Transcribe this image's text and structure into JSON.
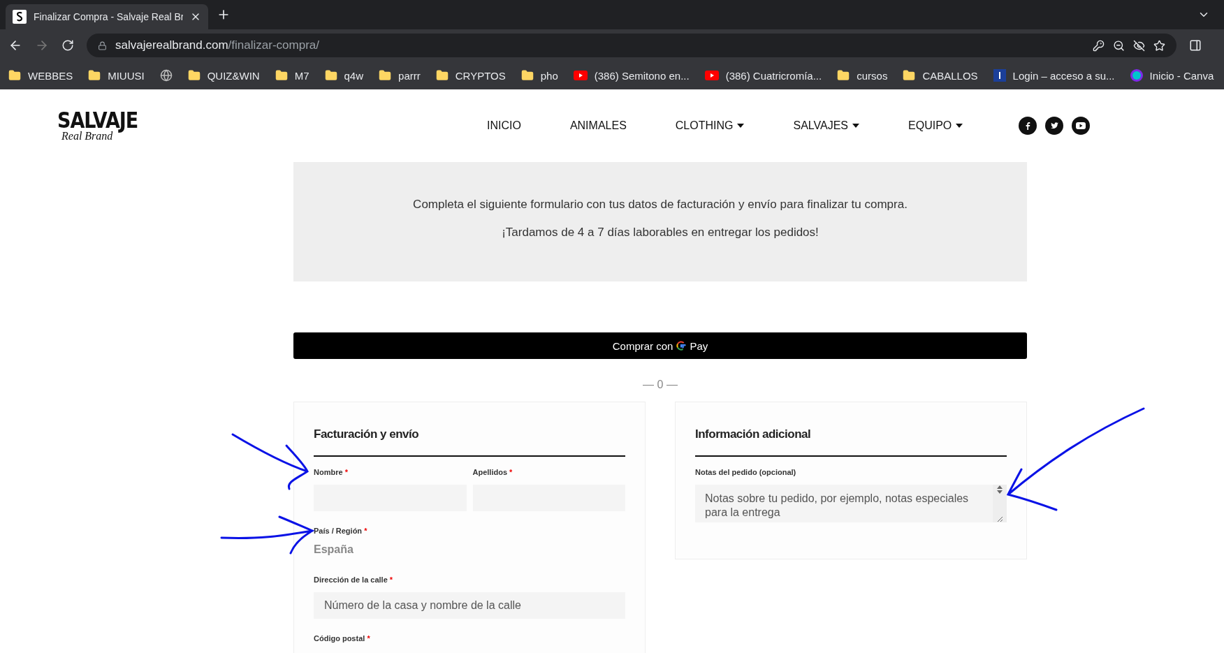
{
  "browser": {
    "tab": {
      "title": "Finalizar Compra - Salvaje Real Br",
      "selected": true
    },
    "address": {
      "domain": "salvajerealbrand.com",
      "path": "/finalizar-compra/"
    },
    "bookmarks": [
      {
        "kind": "folder",
        "label": "WEBBES"
      },
      {
        "kind": "folder",
        "label": "MIUUSI"
      },
      {
        "kind": "globe"
      },
      {
        "kind": "folder",
        "label": "QUIZ&WIN"
      },
      {
        "kind": "folder",
        "label": "M7"
      },
      {
        "kind": "folder",
        "label": "q4w"
      },
      {
        "kind": "folder",
        "label": "parrr"
      },
      {
        "kind": "folder",
        "label": "CRYPTOS"
      },
      {
        "kind": "folder",
        "label": "pho"
      },
      {
        "kind": "video",
        "label": "(386) Semitono en..."
      },
      {
        "kind": "video",
        "label": "(386) Cuatricromía..."
      },
      {
        "kind": "folder",
        "label": "cursos"
      },
      {
        "kind": "folder",
        "label": "CABALLOS"
      },
      {
        "kind": "site",
        "label": "Login – acceso a su..."
      },
      {
        "kind": "canva",
        "label": "Inicio - Canva"
      }
    ]
  },
  "site": {
    "logo": {
      "title": "SALVAJE",
      "subtitle": "Real Brand"
    },
    "nav": [
      {
        "label": "INICIO",
        "dropdown": false
      },
      {
        "label": "ANIMALES",
        "dropdown": false
      },
      {
        "label": "CLOTHING",
        "dropdown": true
      },
      {
        "label": "SALVAJES",
        "dropdown": true
      },
      {
        "label": "EQUIPO",
        "dropdown": true
      }
    ],
    "social": [
      {
        "kind": "facebook"
      },
      {
        "kind": "twitter"
      },
      {
        "kind": "youtube"
      }
    ]
  },
  "intro": {
    "lines": [
      "Completa el siguiente formulario con tus datos de facturación y envío para finalizar tu compra.",
      "¡Tardamos de 4 a 7 días laborables en entregar los pedidos!"
    ]
  },
  "pay_button": {
    "label": "Comprar con",
    "brand": "Pay"
  },
  "separator": "— 0 —",
  "billing": {
    "title": "Facturación y envío",
    "fields": [
      {
        "kind": "input",
        "label": "Nombre",
        "required_mark": "*"
      },
      {
        "kind": "input",
        "label": "Apellidos",
        "required_mark": "*"
      },
      {
        "kind": "static",
        "label": "País / Región",
        "required_mark": "*",
        "value": "España"
      },
      {
        "kind": "input",
        "label": "Dirección de la calle",
        "required_mark": "*",
        "placeholder": "Número de la casa y nombre de la calle"
      },
      {
        "kind": "label",
        "label": "Código postal",
        "required_mark": "*"
      }
    ]
  },
  "additional": {
    "title": "Información adicional",
    "notes": {
      "label": "Notas del pedido (opcional)",
      "placeholder": "Notas sobre tu pedido, por ejemplo, notas especiales para la entrega"
    }
  },
  "annotations": [
    {
      "kind": "arrow"
    },
    {
      "kind": "arrow"
    },
    {
      "kind": "arrow"
    }
  ]
}
